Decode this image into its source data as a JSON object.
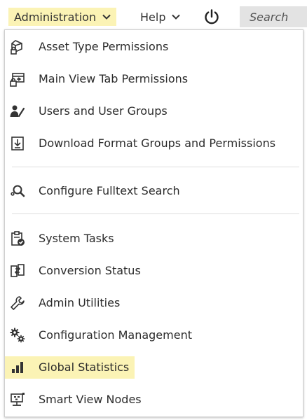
{
  "topbar": {
    "admin_label": "Administration",
    "help_label": "Help",
    "search_placeholder": "Search"
  },
  "menu": {
    "items": [
      {
        "label": "Asset Type Permissions",
        "icon": "asset-type-permissions-icon"
      },
      {
        "label": "Main View Tab Permissions",
        "icon": "tab-permissions-icon"
      },
      {
        "label": "Users and User Groups",
        "icon": "users-icon"
      },
      {
        "label": "Download Format Groups and Permissions",
        "icon": "download-icon"
      },
      {
        "label": "Configure Fulltext Search",
        "icon": "search-config-icon"
      },
      {
        "label": "System Tasks",
        "icon": "clipboard-check-icon"
      },
      {
        "label": "Conversion Status",
        "icon": "conversion-icon"
      },
      {
        "label": "Admin Utilities",
        "icon": "wrench-icon"
      },
      {
        "label": "Configuration Management",
        "icon": "gears-icon"
      },
      {
        "label": "Global Statistics",
        "icon": "bar-chart-icon"
      },
      {
        "label": "Smart View Nodes",
        "icon": "network-icon"
      }
    ]
  },
  "colors": {
    "highlight": "#fbf3b5",
    "search_bg": "#e3e3e3",
    "icon": "#333333"
  }
}
